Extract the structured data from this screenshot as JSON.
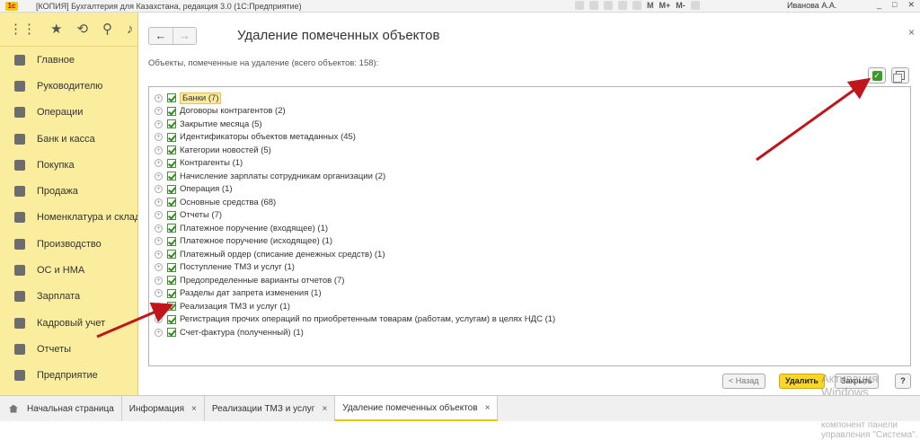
{
  "window": {
    "app_badge": "1c",
    "title": "[КОПИЯ] Бухгалтерия для Казахстана, редакция 3.0  (1С:Предприятие)",
    "toolbar_letters": [
      "M",
      "M+",
      "M-"
    ],
    "user": "Иванова А.А.",
    "controls": [
      "_",
      "□",
      "✕"
    ]
  },
  "sidebar": {
    "items": [
      {
        "label": "Главное",
        "icon": "menu-lines-icon"
      },
      {
        "label": "Руководителю",
        "icon": "trend-icon"
      },
      {
        "label": "Операции",
        "icon": "operations-icon"
      },
      {
        "label": "Банк и касса",
        "icon": "coin-icon"
      },
      {
        "label": "Покупка",
        "icon": "cart-icon"
      },
      {
        "label": "Продажа",
        "icon": "bag-icon"
      },
      {
        "label": "Номенклатура и склад",
        "icon": "warehouse-icon"
      },
      {
        "label": "Производство",
        "icon": "factory-icon"
      },
      {
        "label": "ОС и НМА",
        "icon": "truck-icon"
      },
      {
        "label": "Зарплата",
        "icon": "money-icon"
      },
      {
        "label": "Кадровый учет",
        "icon": "person-icon"
      },
      {
        "label": "Отчеты",
        "icon": "chart-icon"
      },
      {
        "label": "Предприятие",
        "icon": "building-icon"
      }
    ]
  },
  "main": {
    "title": "Удаление помеченных объектов",
    "subtitle": "Объекты, помеченные на удаление (всего объектов: 158):",
    "tree": [
      "Банки (7)",
      "Договоры контрагентов (2)",
      "Закрытие месяца (5)",
      "Идентификаторы объектов метаданных (45)",
      "Категории новостей (5)",
      "Контрагенты (1)",
      "Начисление зарплаты сотрудникам организации (2)",
      "Операция (1)",
      "Основные средства (68)",
      "Отчеты (7)",
      "Платежное поручение (входящее) (1)",
      "Платежное поручение (исходящее) (1)",
      "Платежный ордер (списание денежных средств) (1)",
      "Поступление ТМЗ и услуг (1)",
      "Предопределенные варианты отчетов (7)",
      "Разделы дат запрета изменения (1)",
      "Реализация ТМЗ и услуг (1)",
      "Регистрация прочих операций по приобретенным товарам (работам, услугам) в целях НДС (1)",
      "Счет-фактура (полученный) (1)"
    ],
    "buttons": {
      "back": "< Назад",
      "delete": "Удалить",
      "close": "Закрыть",
      "help": "?"
    }
  },
  "watermark": {
    "line1": "Активация Windows",
    "line2": "Чтобы активировать Windows, перейдите в",
    "line3": "компонент панели управления \"Система\"."
  },
  "tabs": [
    {
      "label": "Начальная страница"
    },
    {
      "label": "Информация"
    },
    {
      "label": "Реализации ТМЗ и услуг"
    },
    {
      "label": "Удаление помеченных объектов"
    }
  ],
  "colors": {
    "sidebar_bg": "#fbed9e",
    "accent_yellow": "#f9d627",
    "check_green": "#2f8a1e",
    "annotation_red": "#c0161b"
  }
}
